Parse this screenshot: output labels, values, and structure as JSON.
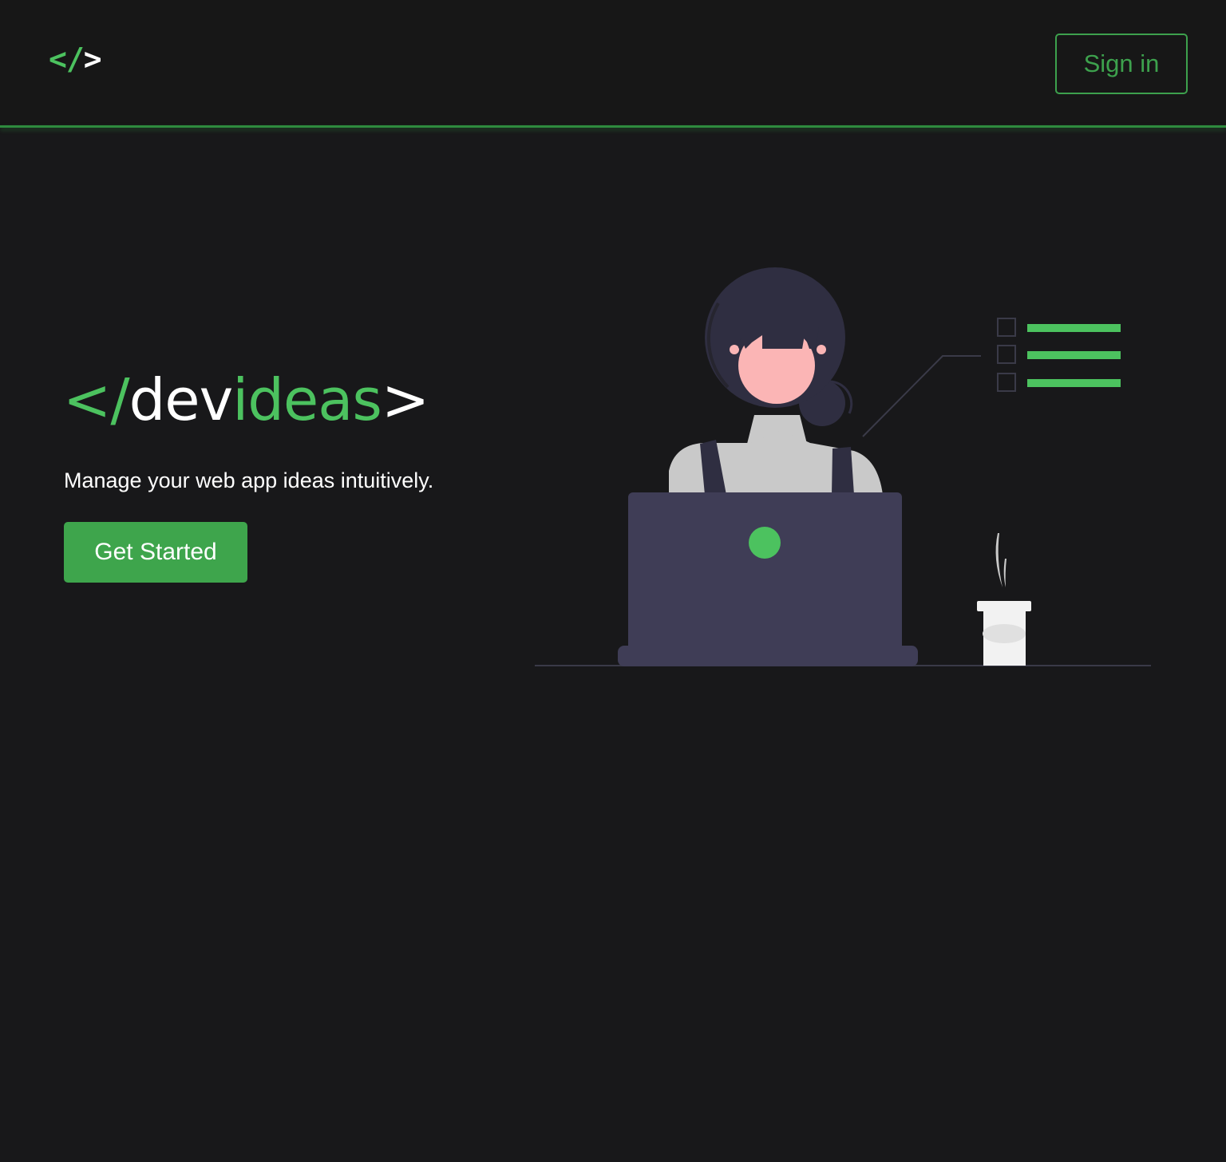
{
  "header": {
    "logo": {
      "open": "</",
      "close": ">"
    },
    "sign_in_label": "Sign in"
  },
  "hero": {
    "title": {
      "prefix": "</",
      "part1": "dev",
      "part2": "ideas",
      "suffix": ">"
    },
    "tagline": "Manage your web app ideas intuitively.",
    "cta_label": "Get Started"
  },
  "illustration": {
    "subject": "woman-at-laptop",
    "checklist_items": 3,
    "accent_color": "#4cc25f"
  },
  "colors": {
    "background": "#18181a",
    "accent": "#4cc25f",
    "button": "#3ea54c",
    "text": "#ffffff"
  }
}
